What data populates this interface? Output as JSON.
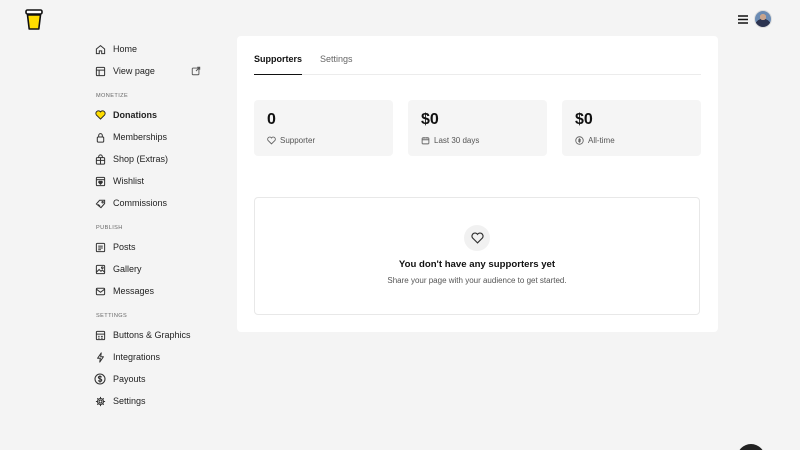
{
  "sidebar": {
    "top_items": [
      {
        "label": "Home",
        "icon": "home-icon"
      },
      {
        "label": "View page",
        "icon": "layout-icon",
        "trailing_icon": "external-link-icon"
      }
    ],
    "sections": [
      {
        "label": "MONETIZE",
        "items": [
          {
            "label": "Donations",
            "icon": "heart-icon",
            "active": true
          },
          {
            "label": "Memberships",
            "icon": "lock-icon"
          },
          {
            "label": "Shop (Extras)",
            "icon": "bag-icon"
          },
          {
            "label": "Wishlist",
            "icon": "wishlist-icon"
          },
          {
            "label": "Commissions",
            "icon": "commission-icon"
          }
        ]
      },
      {
        "label": "PUBLISH",
        "items": [
          {
            "label": "Posts",
            "icon": "document-icon"
          },
          {
            "label": "Gallery",
            "icon": "image-icon"
          },
          {
            "label": "Messages",
            "icon": "mail-icon"
          }
        ]
      },
      {
        "label": "SETTINGS",
        "items": [
          {
            "label": "Buttons & Graphics",
            "icon": "graphics-icon"
          },
          {
            "label": "Integrations",
            "icon": "bolt-icon"
          },
          {
            "label": "Payouts",
            "icon": "dollar-icon"
          },
          {
            "label": "Settings",
            "icon": "gear-icon"
          }
        ]
      }
    ]
  },
  "tabs": [
    {
      "label": "Supporters",
      "active": true
    },
    {
      "label": "Settings",
      "active": false
    }
  ],
  "stats": [
    {
      "value": "0",
      "label": "Supporter",
      "icon": "heart-outline-icon"
    },
    {
      "value": "$0",
      "label": "Last 30 days",
      "icon": "calendar-icon"
    },
    {
      "value": "$0",
      "label": "All-time",
      "icon": "coin-icon"
    }
  ],
  "empty_state": {
    "icon": "heart-outline-icon",
    "title": "You don't have any supporters yet",
    "subtitle": "Share your page with your audience to get started."
  },
  "colors": {
    "background": "#f4f4f4",
    "panel": "#ffffff",
    "accent_heart": "#ffdd00",
    "text": "#222222"
  }
}
